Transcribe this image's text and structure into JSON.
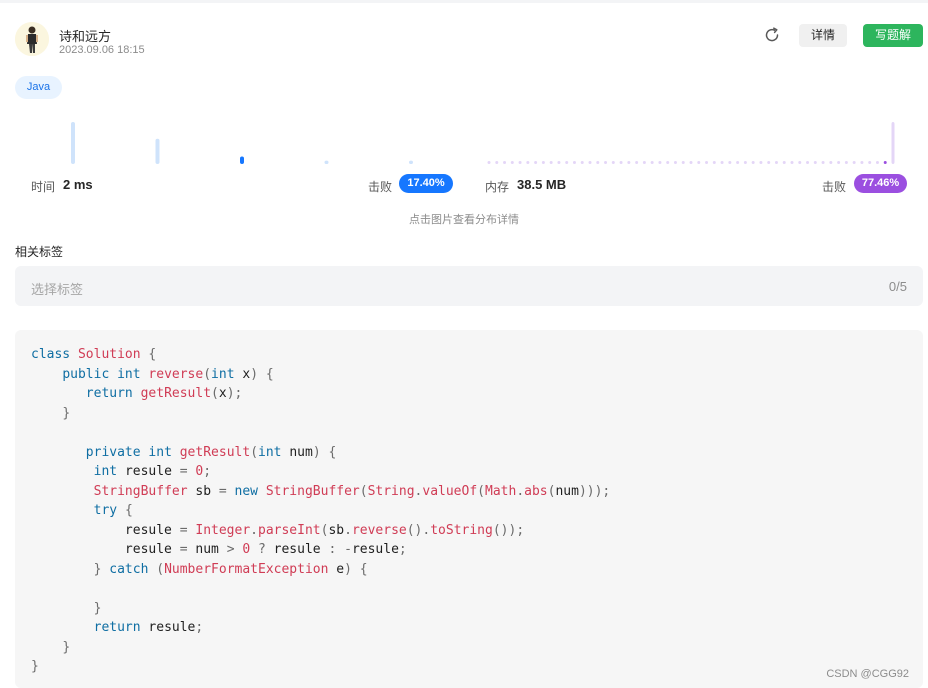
{
  "header": {
    "username": "诗和远方",
    "timestamp": "2023.09.06 18:15",
    "detail_label": "详情",
    "write_solution_label": "写题解"
  },
  "language_tag": "Java",
  "stats": {
    "time_label": "时间",
    "time_value": "2 ms",
    "time_beats_label": "击败",
    "time_beats": "17.40%",
    "memory_label": "内存",
    "memory_value": "38.5 MB",
    "memory_beats_label": "击败",
    "memory_beats": "77.46%",
    "chart_hint": "点击图片查看分布详情"
  },
  "chart_data": [
    {
      "type": "bar",
      "series": [
        {
          "values": [
            1.0,
            0.6,
            0.18,
            0.08,
            0.08
          ]
        }
      ],
      "highlight_index": 2,
      "colors": {
        "bar": "#cfe3fb",
        "highlight": "#1677ff"
      }
    },
    {
      "type": "bar",
      "series": [
        {
          "values": [
            0.05,
            0.05,
            0.05,
            0.05,
            0.05,
            0.05,
            0.05,
            0.05,
            0.05,
            0.05,
            0.05,
            0.05,
            0.05,
            0.05,
            0.05,
            0.05,
            0.05,
            0.05,
            0.05,
            0.05,
            0.05,
            0.05,
            0.05,
            0.05,
            0.05,
            0.05,
            0.05,
            0.05,
            0.05,
            0.05,
            0.05,
            0.05,
            0.05,
            0.05,
            0.05,
            0.05,
            0.05,
            0.05,
            0.05,
            0.05,
            0.05,
            0.05,
            0.05,
            0.05,
            0.05,
            0.05,
            0.05,
            0.05,
            0.05,
            0.05,
            0.05,
            0.05,
            1.0
          ]
        }
      ],
      "highlight_index": 51,
      "colors": {
        "bar": "#e4d6f7",
        "highlight": "#9b4fe0"
      }
    }
  ],
  "tags": {
    "section_title": "相关标签",
    "placeholder": "选择标签",
    "counter": "0/5"
  },
  "code": {
    "lines": [
      [
        {
          "t": "class ",
          "c": "kw"
        },
        {
          "t": "Solution ",
          "c": "fn"
        },
        {
          "t": "{",
          "c": "pn"
        }
      ],
      [
        {
          "t": "    "
        },
        {
          "t": "public ",
          "c": "kw"
        },
        {
          "t": "int ",
          "c": "kw"
        },
        {
          "t": "reverse",
          "c": "fn"
        },
        {
          "t": "(",
          "c": "pn"
        },
        {
          "t": "int ",
          "c": "kw"
        },
        {
          "t": "x"
        },
        {
          "t": ") {",
          "c": "pn"
        }
      ],
      [
        {
          "t": "       "
        },
        {
          "t": "return ",
          "c": "kw"
        },
        {
          "t": "getResult",
          "c": "fn"
        },
        {
          "t": "(",
          "c": "pn"
        },
        {
          "t": "x"
        },
        {
          "t": ");",
          "c": "pn"
        }
      ],
      [
        {
          "t": "    "
        },
        {
          "t": "}",
          "c": "pn"
        }
      ],
      [
        {
          "t": ""
        }
      ],
      [
        {
          "t": "       "
        },
        {
          "t": "private ",
          "c": "kw"
        },
        {
          "t": "int ",
          "c": "kw"
        },
        {
          "t": "getResult",
          "c": "fn"
        },
        {
          "t": "(",
          "c": "pn"
        },
        {
          "t": "int ",
          "c": "kw"
        },
        {
          "t": "num"
        },
        {
          "t": ") {",
          "c": "pn"
        }
      ],
      [
        {
          "t": "        "
        },
        {
          "t": "int ",
          "c": "kw"
        },
        {
          "t": "resule "
        },
        {
          "t": "= ",
          "c": "pn"
        },
        {
          "t": "0",
          "c": "num"
        },
        {
          "t": ";",
          "c": "pn"
        }
      ],
      [
        {
          "t": "        "
        },
        {
          "t": "StringBuffer ",
          "c": "fn"
        },
        {
          "t": "sb "
        },
        {
          "t": "= ",
          "c": "pn"
        },
        {
          "t": "new ",
          "c": "kw"
        },
        {
          "t": "StringBuffer",
          "c": "fn"
        },
        {
          "t": "(",
          "c": "pn"
        },
        {
          "t": "String",
          "c": "fn"
        },
        {
          "t": ".",
          "c": "pn"
        },
        {
          "t": "valueOf",
          "c": "fn"
        },
        {
          "t": "(",
          "c": "pn"
        },
        {
          "t": "Math",
          "c": "fn"
        },
        {
          "t": ".",
          "c": "pn"
        },
        {
          "t": "abs",
          "c": "fn"
        },
        {
          "t": "(",
          "c": "pn"
        },
        {
          "t": "num"
        },
        {
          "t": ")));",
          "c": "pn"
        }
      ],
      [
        {
          "t": "        "
        },
        {
          "t": "try ",
          "c": "kw"
        },
        {
          "t": "{",
          "c": "pn"
        }
      ],
      [
        {
          "t": "            "
        },
        {
          "t": "resule "
        },
        {
          "t": "= ",
          "c": "pn"
        },
        {
          "t": "Integer",
          "c": "fn"
        },
        {
          "t": ".",
          "c": "pn"
        },
        {
          "t": "parseInt",
          "c": "fn"
        },
        {
          "t": "(",
          "c": "pn"
        },
        {
          "t": "sb"
        },
        {
          "t": ".",
          "c": "pn"
        },
        {
          "t": "reverse",
          "c": "fn"
        },
        {
          "t": "().",
          "c": "pn"
        },
        {
          "t": "toString",
          "c": "fn"
        },
        {
          "t": "());",
          "c": "pn"
        }
      ],
      [
        {
          "t": "            "
        },
        {
          "t": "resule "
        },
        {
          "t": "= ",
          "c": "pn"
        },
        {
          "t": "num "
        },
        {
          "t": "> ",
          "c": "pn"
        },
        {
          "t": "0 ",
          "c": "num"
        },
        {
          "t": "? ",
          "c": "pn"
        },
        {
          "t": "resule "
        },
        {
          "t": ": -",
          "c": "pn"
        },
        {
          "t": "resule"
        },
        {
          "t": ";",
          "c": "pn"
        }
      ],
      [
        {
          "t": "        "
        },
        {
          "t": "} ",
          "c": "pn"
        },
        {
          "t": "catch ",
          "c": "kw"
        },
        {
          "t": "(",
          "c": "pn"
        },
        {
          "t": "NumberFormatException ",
          "c": "fn"
        },
        {
          "t": "e"
        },
        {
          "t": ") {",
          "c": "pn"
        }
      ],
      [
        {
          "t": ""
        }
      ],
      [
        {
          "t": "        "
        },
        {
          "t": "}",
          "c": "pn"
        }
      ],
      [
        {
          "t": "        "
        },
        {
          "t": "return ",
          "c": "kw"
        },
        {
          "t": "resule"
        },
        {
          "t": ";",
          "c": "pn"
        }
      ],
      [
        {
          "t": "    "
        },
        {
          "t": "}",
          "c": "pn"
        }
      ],
      [
        {
          "t": "}",
          "c": "pn"
        }
      ]
    ]
  },
  "watermark": "CSDN @CGG92"
}
